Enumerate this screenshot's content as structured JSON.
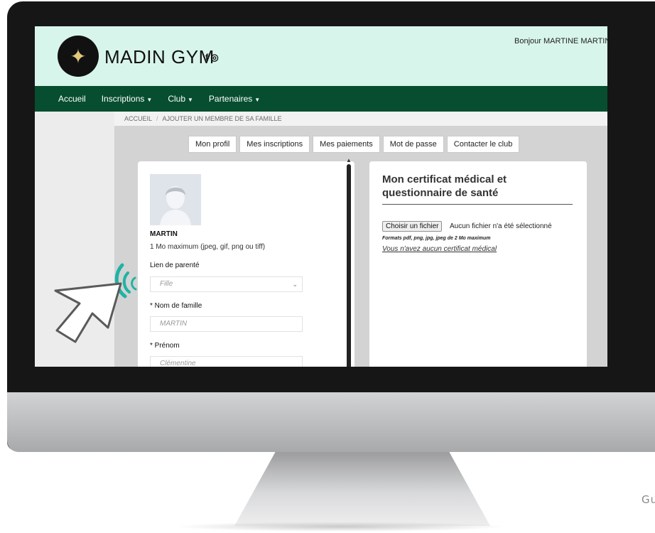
{
  "header": {
    "brand": "MADIN GYM",
    "greeting": "Bonjour MARTINE MARTIN"
  },
  "icons": {
    "facebook": "facebook-icon",
    "instagram": "instagram-icon",
    "logo": "gymnast-logo-icon"
  },
  "nav": {
    "items": [
      {
        "label": "Accueil",
        "dropdown": false
      },
      {
        "label": "Inscriptions",
        "dropdown": true
      },
      {
        "label": "Club",
        "dropdown": true
      },
      {
        "label": "Partenaires",
        "dropdown": true
      }
    ]
  },
  "breadcrumb": {
    "home": "ACCUEIL",
    "current": "AJOUTER UN MEMBRE DE SA FAMILLE"
  },
  "tabs": [
    "Mon profil",
    "Mes inscriptions",
    "Mes paiements",
    "Mot de passe",
    "Contacter le club"
  ],
  "profile": {
    "last_name_display": "MARTIN",
    "photo_hint": "1 Mo maximum (jpeg, gif, png ou tiff)",
    "relation_label": "Lien de parenté",
    "relation_value": "Fille",
    "surname_label": "* Nom de famille",
    "surname_value": "MARTIN",
    "firstname_label": "* Prénom",
    "firstname_value": "Clémentine"
  },
  "certificate": {
    "title": "Mon certificat médical et questionnaire de santé",
    "choose_file": "Choisir un fichier",
    "file_status": "Aucun fichier n'a été sélectionné",
    "formats": "Formats pdf, png, jpg, jpeg de 2 Mo maximum",
    "no_certificate": "Vous n'avez aucun certificat médical"
  },
  "watermark": "Gu",
  "colors": {
    "header_bg": "#d8f5ec",
    "nav_bg": "#064e2f",
    "accent_teal": "#1fb3a5"
  }
}
